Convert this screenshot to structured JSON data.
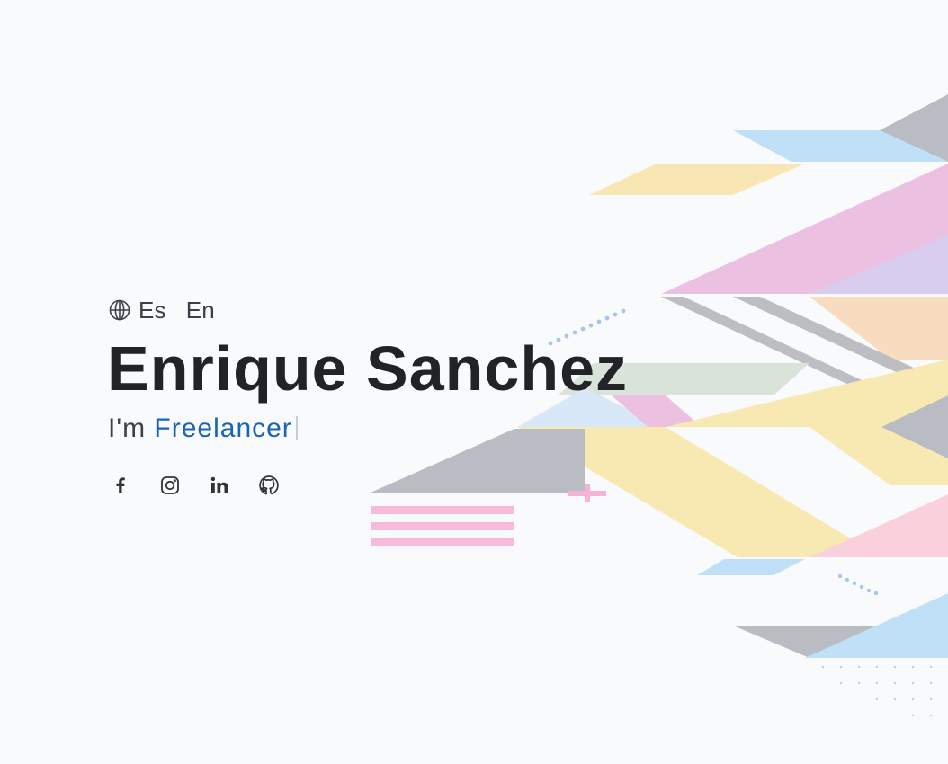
{
  "language_switcher": {
    "icon": "globe-icon",
    "options": [
      "Es",
      "En"
    ]
  },
  "hero": {
    "name": "Enrique Sanchez",
    "tagline_prefix": "I'm",
    "tagline_role": "Freelancer"
  },
  "social_links": [
    {
      "icon": "facebook-icon"
    },
    {
      "icon": "instagram-icon"
    },
    {
      "icon": "linkedin-icon"
    },
    {
      "icon": "github-icon"
    }
  ],
  "colors": {
    "background": "#f9fafc",
    "name_text": "#222326",
    "body_text": "#3c4048",
    "accent": "#1a64b4"
  }
}
